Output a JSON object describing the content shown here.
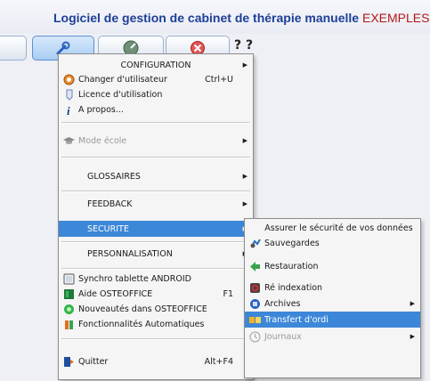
{
  "window": {
    "title": "Logiciel de gestion de cabinet de thérapie manuelle",
    "title_extra": "EXEMPLES"
  },
  "toolbar": {
    "help_mark": "? ?"
  },
  "menu": {
    "configuration": "CONFIGURATION",
    "changer_utilisateur": "Changer d'utilisateur",
    "changer_utilisateur_shortcut": "Ctrl+U",
    "licence": "Licence d'utilisation",
    "apropos": "A propos...",
    "mode_ecole": "Mode école",
    "glossaires": "GLOSSAIRES",
    "feedback": "FEEDBACK",
    "securite": "SECURITE",
    "personnalisation": "PERSONNALISATION",
    "synchro": "Synchro tablette ANDROID",
    "aide": "Aide OSTEOFFICE",
    "aide_shortcut": "F1",
    "nouveautes": "Nouveautés dans OSTEOFFICE",
    "fonctionnalites": "Fonctionnalités Automatiques",
    "quitter": "Quitter",
    "quitter_shortcut": "Alt+F4"
  },
  "submenu": {
    "header": "Assurer le sécurité de vos données",
    "sauvegardes": "Sauvegardes",
    "restauration": "Restauration",
    "reindexation": "Ré indexation",
    "archives": "Archives",
    "transfert": "Transfert d'ordi",
    "journaux": "Journaux"
  },
  "colors": {
    "title": "#1e3f96",
    "title_extra": "#b31717",
    "highlight": "#3d87d8"
  }
}
